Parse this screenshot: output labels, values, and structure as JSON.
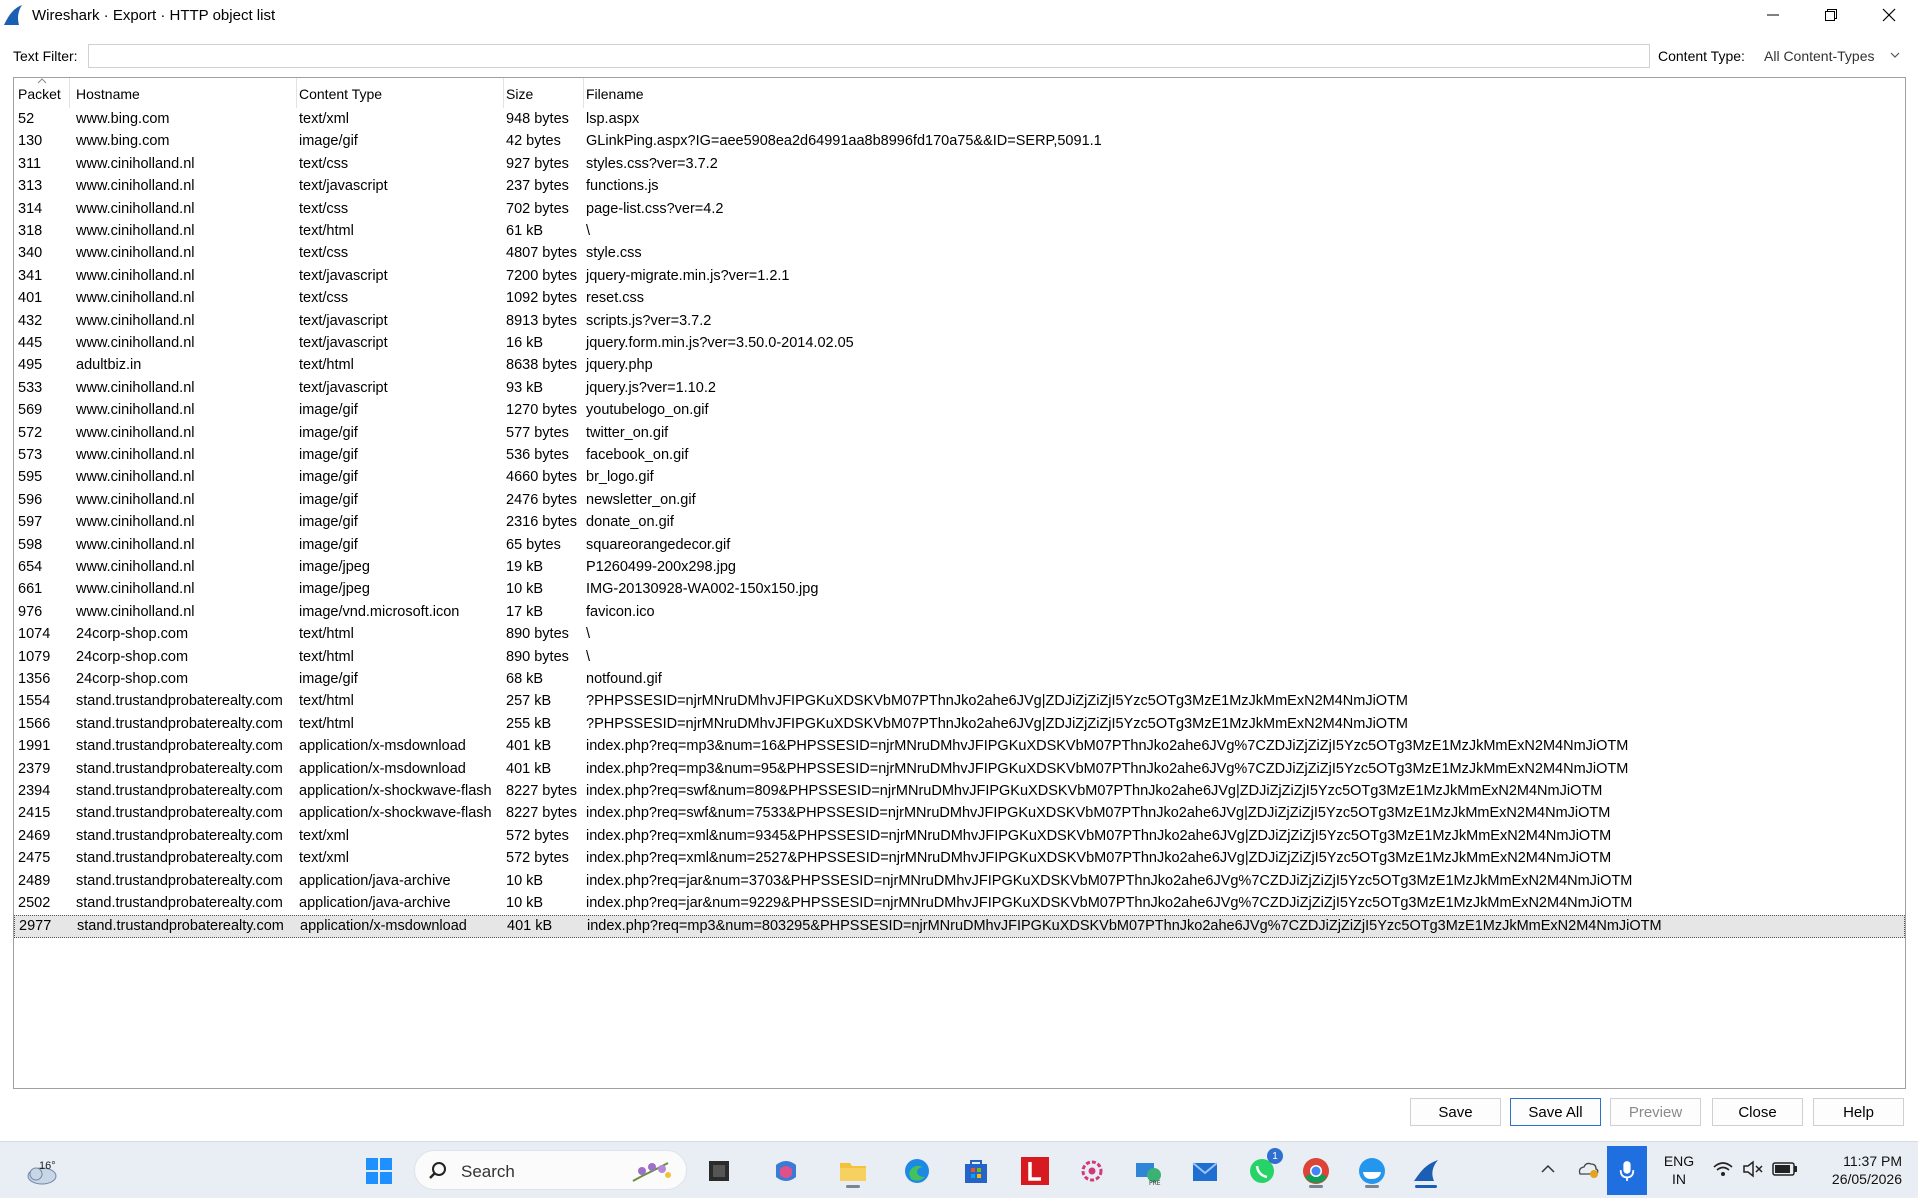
{
  "window": {
    "title": "Wireshark · Export · HTTP object list"
  },
  "filter": {
    "text_filter_label": "Text Filter:",
    "text_filter_value": "",
    "content_type_label": "Content Type:",
    "content_type_value": "All Content-Types"
  },
  "table": {
    "columns": {
      "packet": "Packet",
      "hostname": "Hostname",
      "content_type": "Content Type",
      "size": "Size",
      "filename": "Filename"
    },
    "rows": [
      {
        "packet": "52",
        "hostname": "www.bing.com",
        "content_type": "text/xml",
        "size": "948 bytes",
        "filename": "lsp.aspx"
      },
      {
        "packet": "130",
        "hostname": "www.bing.com",
        "content_type": "image/gif",
        "size": "42 bytes",
        "filename": "GLinkPing.aspx?IG=aee5908ea2d64991aa8b8996fd170a75&&ID=SERP,5091.1"
      },
      {
        "packet": "311",
        "hostname": "www.ciniholland.nl",
        "content_type": "text/css",
        "size": "927 bytes",
        "filename": "styles.css?ver=3.7.2"
      },
      {
        "packet": "313",
        "hostname": "www.ciniholland.nl",
        "content_type": "text/javascript",
        "size": "237 bytes",
        "filename": "functions.js"
      },
      {
        "packet": "314",
        "hostname": "www.ciniholland.nl",
        "content_type": "text/css",
        "size": "702 bytes",
        "filename": "page-list.css?ver=4.2"
      },
      {
        "packet": "318",
        "hostname": "www.ciniholland.nl",
        "content_type": "text/html",
        "size": "61 kB",
        "filename": "\\"
      },
      {
        "packet": "340",
        "hostname": "www.ciniholland.nl",
        "content_type": "text/css",
        "size": "4807 bytes",
        "filename": "style.css"
      },
      {
        "packet": "341",
        "hostname": "www.ciniholland.nl",
        "content_type": "text/javascript",
        "size": "7200 bytes",
        "filename": "jquery-migrate.min.js?ver=1.2.1"
      },
      {
        "packet": "401",
        "hostname": "www.ciniholland.nl",
        "content_type": "text/css",
        "size": "1092 bytes",
        "filename": "reset.css"
      },
      {
        "packet": "432",
        "hostname": "www.ciniholland.nl",
        "content_type": "text/javascript",
        "size": "8913 bytes",
        "filename": "scripts.js?ver=3.7.2"
      },
      {
        "packet": "445",
        "hostname": "www.ciniholland.nl",
        "content_type": "text/javascript",
        "size": "16 kB",
        "filename": "jquery.form.min.js?ver=3.50.0-2014.02.05"
      },
      {
        "packet": "495",
        "hostname": "adultbiz.in",
        "content_type": "text/html",
        "size": "8638 bytes",
        "filename": "jquery.php"
      },
      {
        "packet": "533",
        "hostname": "www.ciniholland.nl",
        "content_type": "text/javascript",
        "size": "93 kB",
        "filename": "jquery.js?ver=1.10.2"
      },
      {
        "packet": "569",
        "hostname": "www.ciniholland.nl",
        "content_type": "image/gif",
        "size": "1270 bytes",
        "filename": "youtubelogo_on.gif"
      },
      {
        "packet": "572",
        "hostname": "www.ciniholland.nl",
        "content_type": "image/gif",
        "size": "577 bytes",
        "filename": "twitter_on.gif"
      },
      {
        "packet": "573",
        "hostname": "www.ciniholland.nl",
        "content_type": "image/gif",
        "size": "536 bytes",
        "filename": "facebook_on.gif"
      },
      {
        "packet": "595",
        "hostname": "www.ciniholland.nl",
        "content_type": "image/gif",
        "size": "4660 bytes",
        "filename": "br_logo.gif"
      },
      {
        "packet": "596",
        "hostname": "www.ciniholland.nl",
        "content_type": "image/gif",
        "size": "2476 bytes",
        "filename": "newsletter_on.gif"
      },
      {
        "packet": "597",
        "hostname": "www.ciniholland.nl",
        "content_type": "image/gif",
        "size": "2316 bytes",
        "filename": "donate_on.gif"
      },
      {
        "packet": "598",
        "hostname": "www.ciniholland.nl",
        "content_type": "image/gif",
        "size": "65 bytes",
        "filename": "squareorangedecor.gif"
      },
      {
        "packet": "654",
        "hostname": "www.ciniholland.nl",
        "content_type": "image/jpeg",
        "size": "19 kB",
        "filename": "P1260499-200x298.jpg"
      },
      {
        "packet": "661",
        "hostname": "www.ciniholland.nl",
        "content_type": "image/jpeg",
        "size": "10 kB",
        "filename": "IMG-20130928-WA002-150x150.jpg"
      },
      {
        "packet": "976",
        "hostname": "www.ciniholland.nl",
        "content_type": "image/vnd.microsoft.icon",
        "size": "17 kB",
        "filename": "favicon.ico"
      },
      {
        "packet": "1074",
        "hostname": "24corp-shop.com",
        "content_type": "text/html",
        "size": "890 bytes",
        "filename": "\\"
      },
      {
        "packet": "1079",
        "hostname": "24corp-shop.com",
        "content_type": "text/html",
        "size": "890 bytes",
        "filename": "\\"
      },
      {
        "packet": "1356",
        "hostname": "24corp-shop.com",
        "content_type": "image/gif",
        "size": "68 kB",
        "filename": "notfound.gif"
      },
      {
        "packet": "1554",
        "hostname": "stand.trustandprobaterealty.com",
        "content_type": "text/html",
        "size": "257 kB",
        "filename": "?PHPSSESID=njrMNruDMhvJFIPGKuXDSKVbM07PThnJko2ahe6JVg|ZDJiZjZiZjI5Yzc5OTg3MzE1MzJkMmExN2M4NmJiOTM"
      },
      {
        "packet": "1566",
        "hostname": "stand.trustandprobaterealty.com",
        "content_type": "text/html",
        "size": "255 kB",
        "filename": "?PHPSSESID=njrMNruDMhvJFIPGKuXDSKVbM07PThnJko2ahe6JVg|ZDJiZjZiZjI5Yzc5OTg3MzE1MzJkMmExN2M4NmJiOTM"
      },
      {
        "packet": "1991",
        "hostname": "stand.trustandprobaterealty.com",
        "content_type": "application/x-msdownload",
        "size": "401 kB",
        "filename": "index.php?req=mp3&num=16&PHPSSESID=njrMNruDMhvJFIPGKuXDSKVbM07PThnJko2ahe6JVg%7CZDJiZjZiZjI5Yzc5OTg3MzE1MzJkMmExN2M4NmJiOTM"
      },
      {
        "packet": "2379",
        "hostname": "stand.trustandprobaterealty.com",
        "content_type": "application/x-msdownload",
        "size": "401 kB",
        "filename": "index.php?req=mp3&num=95&PHPSSESID=njrMNruDMhvJFIPGKuXDSKVbM07PThnJko2ahe6JVg%7CZDJiZjZiZjI5Yzc5OTg3MzE1MzJkMmExN2M4NmJiOTM"
      },
      {
        "packet": "2394",
        "hostname": "stand.trustandprobaterealty.com",
        "content_type": "application/x-shockwave-flash",
        "size": "8227 bytes",
        "filename": "index.php?req=swf&num=809&PHPSSESID=njrMNruDMhvJFIPGKuXDSKVbM07PThnJko2ahe6JVg|ZDJiZjZiZjI5Yzc5OTg3MzE1MzJkMmExN2M4NmJiOTM"
      },
      {
        "packet": "2415",
        "hostname": "stand.trustandprobaterealty.com",
        "content_type": "application/x-shockwave-flash",
        "size": "8227 bytes",
        "filename": "index.php?req=swf&num=7533&PHPSSESID=njrMNruDMhvJFIPGKuXDSKVbM07PThnJko2ahe6JVg|ZDJiZjZiZjI5Yzc5OTg3MzE1MzJkMmExN2M4NmJiOTM"
      },
      {
        "packet": "2469",
        "hostname": "stand.trustandprobaterealty.com",
        "content_type": "text/xml",
        "size": "572 bytes",
        "filename": "index.php?req=xml&num=9345&PHPSSESID=njrMNruDMhvJFIPGKuXDSKVbM07PThnJko2ahe6JVg|ZDJiZjZiZjI5Yzc5OTg3MzE1MzJkMmExN2M4NmJiOTM"
      },
      {
        "packet": "2475",
        "hostname": "stand.trustandprobaterealty.com",
        "content_type": "text/xml",
        "size": "572 bytes",
        "filename": "index.php?req=xml&num=2527&PHPSSESID=njrMNruDMhvJFIPGKuXDSKVbM07PThnJko2ahe6JVg|ZDJiZjZiZjI5Yzc5OTg3MzE1MzJkMmExN2M4NmJiOTM"
      },
      {
        "packet": "2489",
        "hostname": "stand.trustandprobaterealty.com",
        "content_type": "application/java-archive",
        "size": "10 kB",
        "filename": "index.php?req=jar&num=3703&PHPSSESID=njrMNruDMhvJFIPGKuXDSKVbM07PThnJko2ahe6JVg%7CZDJiZjZiZjI5Yzc5OTg3MzE1MzJkMmExN2M4NmJiOTM"
      },
      {
        "packet": "2502",
        "hostname": "stand.trustandprobaterealty.com",
        "content_type": "application/java-archive",
        "size": "10 kB",
        "filename": "index.php?req=jar&num=9229&PHPSSESID=njrMNruDMhvJFIPGKuXDSKVbM07PThnJko2ahe6JVg%7CZDJiZjZiZjI5Yzc5OTg3MzE1MzJkMmExN2M4NmJiOTM"
      },
      {
        "packet": "2977",
        "hostname": "stand.trustandprobaterealty.com",
        "content_type": "application/x-msdownload",
        "size": "401 kB",
        "filename": "index.php?req=mp3&num=803295&PHPSSESID=njrMNruDMhvJFIPGKuXDSKVbM07PThnJko2ahe6JVg%7CZDJiZjZiZjI5Yzc5OTg3MzE1MzJkMmExN2M4NmJiOTM",
        "selected": true
      }
    ]
  },
  "buttons": {
    "save": "Save",
    "save_all": "Save All",
    "preview": "Preview",
    "close": "Close",
    "help": "Help"
  },
  "taskbar": {
    "weather_temp": "16°",
    "search_placeholder": "Search",
    "whatsapp_badge": "1",
    "language_line1": "ENG",
    "language_line2": "IN",
    "time": "11:37 PM",
    "date": "26/05/2026",
    "icons": [
      "windows-start-icon",
      "search-icon",
      "task-view-icon",
      "m365-copilot-icon",
      "file-explorer-icon",
      "edge-icon",
      "microsoft-store-icon",
      "l-app-icon",
      "settings-gear-icon",
      "network-app-icon",
      "outlook-icon",
      "whatsapp-icon",
      "chrome-icon",
      "docker-icon",
      "wireshark-icon"
    ]
  },
  "colors": {
    "selected_row": "#e6e6e6",
    "primary_button_border": "#2a74c8",
    "taskbar_bg": "#e9eef4",
    "mic_tile": "#1f6fe0"
  }
}
